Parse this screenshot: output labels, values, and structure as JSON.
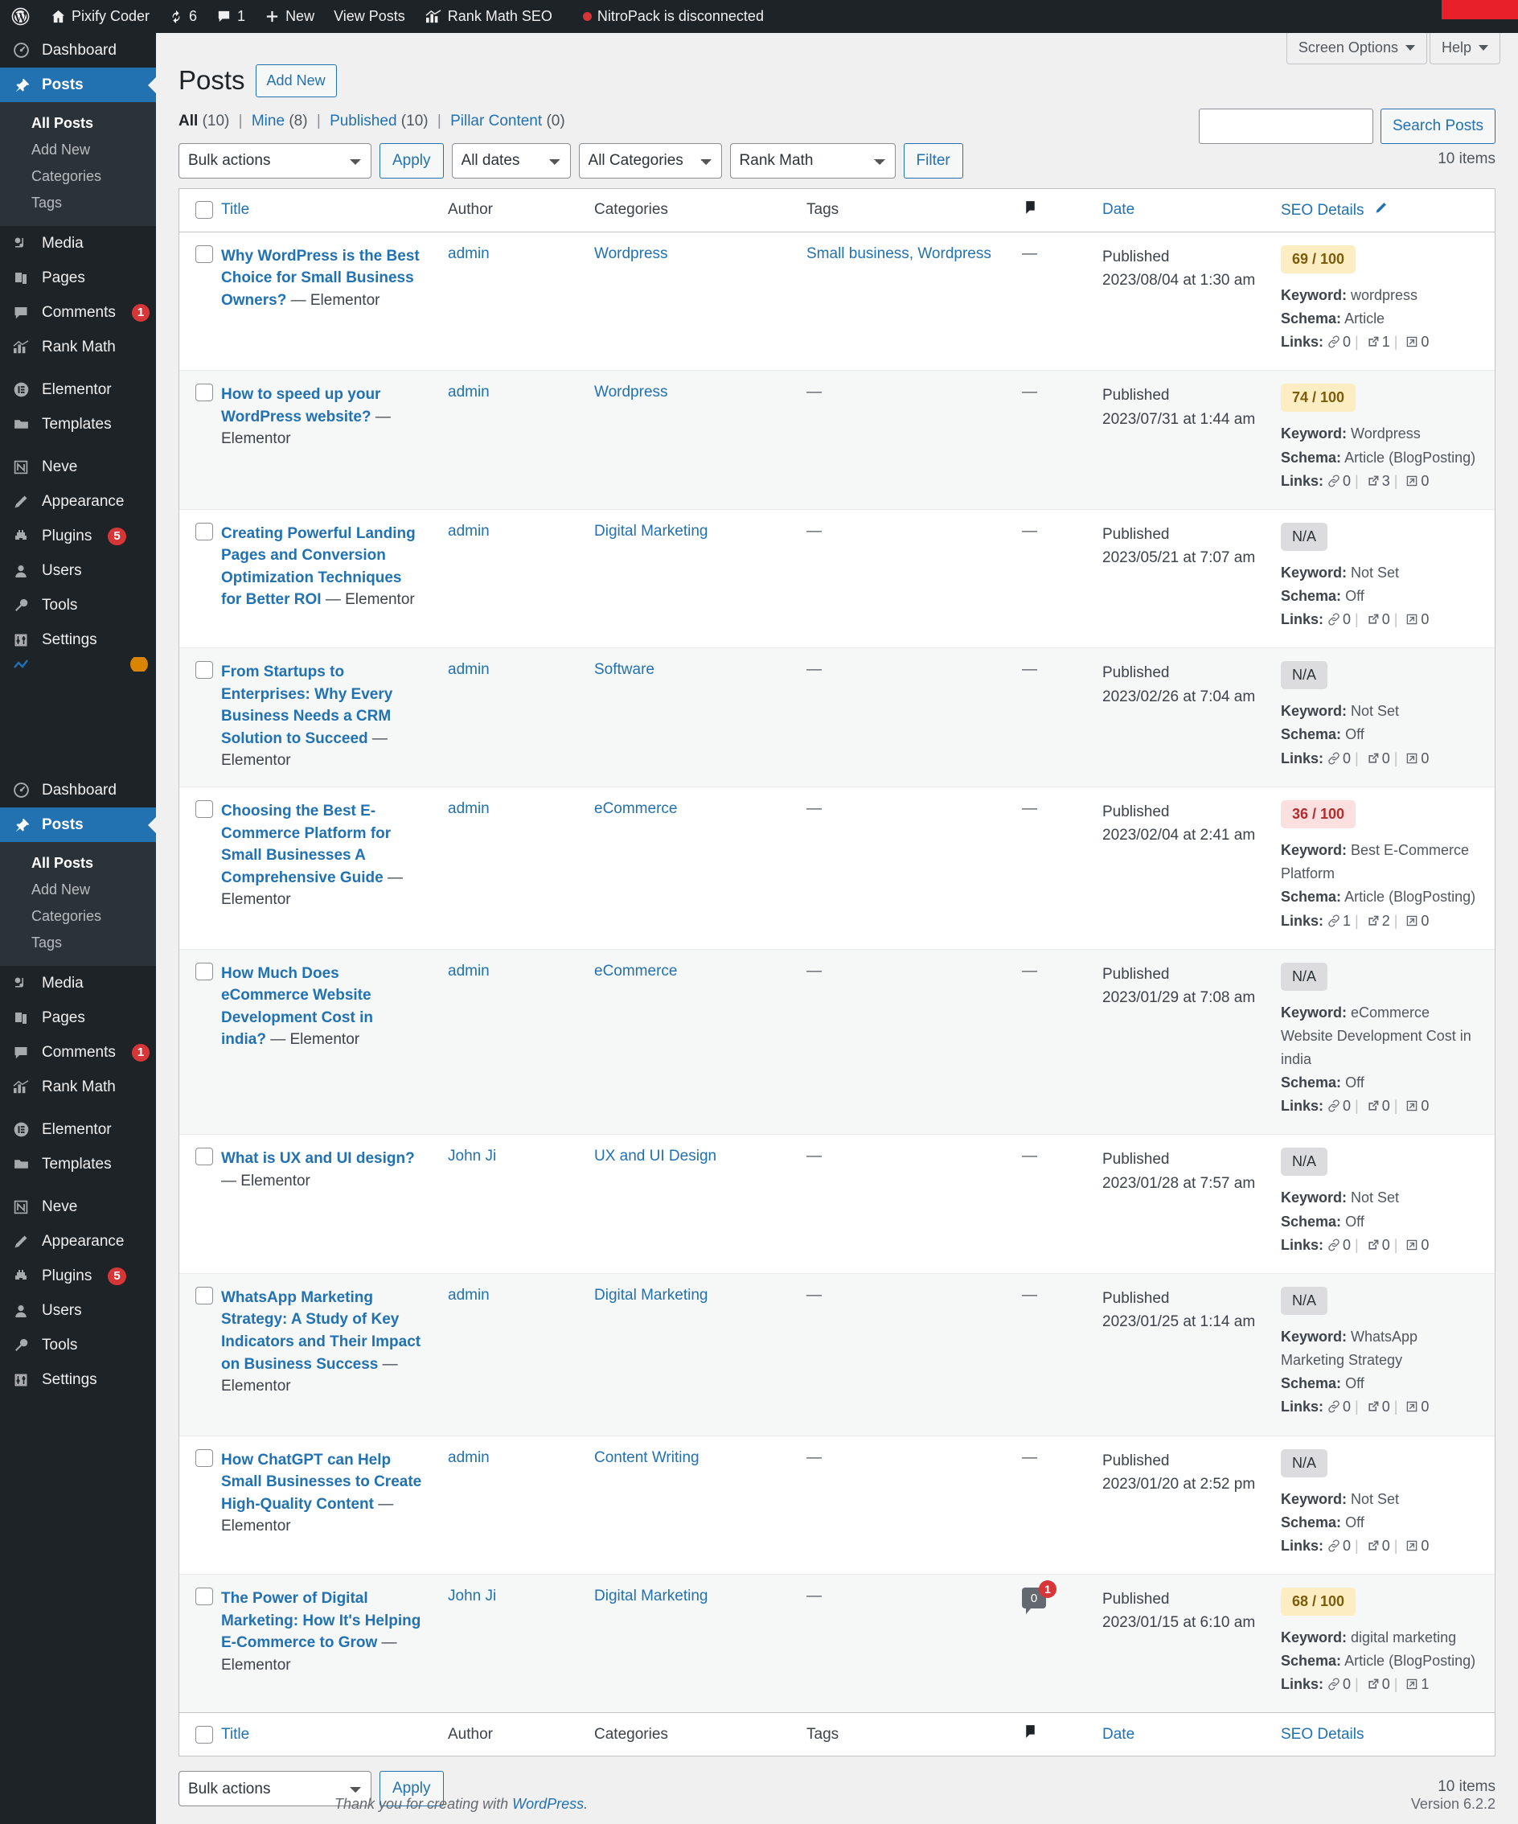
{
  "adminbar": {
    "wp_logo": "wordpress-logo-icon",
    "site_name": "Pixify Coder",
    "updates_count": "6",
    "comments_count": "1",
    "new_label": "New",
    "view_posts_label": "View Posts",
    "rank_math_label": "Rank Math SEO",
    "nitropack_label": "NitroPack is disconnected"
  },
  "sidebar": {
    "groups": [
      {
        "items": [
          {
            "label": "Dashboard",
            "icon": "dashboard-icon",
            "current": false
          },
          {
            "label": "Posts",
            "icon": "pin-icon",
            "current": true,
            "submenu": [
              {
                "label": "All Posts",
                "current": true
              },
              {
                "label": "Add New",
                "current": false
              },
              {
                "label": "Categories",
                "current": false
              },
              {
                "label": "Tags",
                "current": false
              }
            ]
          },
          {
            "label": "Media",
            "icon": "media-icon",
            "current": false
          },
          {
            "label": "Pages",
            "icon": "pages-icon",
            "current": false
          },
          {
            "label": "Comments",
            "icon": "comment-icon",
            "current": false,
            "badge": "1"
          },
          {
            "label": "Rank Math",
            "icon": "rank-math-icon",
            "current": false
          },
          {
            "label": "Elementor",
            "icon": "elementor-icon",
            "current": false
          },
          {
            "label": "Templates",
            "icon": "folder-icon",
            "current": false
          },
          {
            "label": "Neve",
            "icon": "neve-icon",
            "current": false
          },
          {
            "label": "Appearance",
            "icon": "appearance-icon",
            "current": false
          },
          {
            "label": "Plugins",
            "icon": "plugins-icon",
            "current": false,
            "badge": "5"
          },
          {
            "label": "Users",
            "icon": "users-icon",
            "current": false
          },
          {
            "label": "Tools",
            "icon": "tools-icon",
            "current": false
          },
          {
            "label": "Settings",
            "icon": "settings-icon",
            "current": false
          }
        ]
      },
      {
        "items": [
          {
            "label": "Dashboard",
            "icon": "dashboard-icon",
            "current": false
          },
          {
            "label": "Posts",
            "icon": "pin-icon",
            "current": true,
            "submenu": [
              {
                "label": "All Posts",
                "current": true
              },
              {
                "label": "Add New",
                "current": false
              },
              {
                "label": "Categories",
                "current": false
              },
              {
                "label": "Tags",
                "current": false
              }
            ]
          },
          {
            "label": "Media",
            "icon": "media-icon",
            "current": false
          },
          {
            "label": "Pages",
            "icon": "pages-icon",
            "current": false
          },
          {
            "label": "Comments",
            "icon": "comment-icon",
            "current": false,
            "badge": "1"
          },
          {
            "label": "Rank Math",
            "icon": "rank-math-icon",
            "current": false
          },
          {
            "label": "Elementor",
            "icon": "elementor-icon",
            "current": false
          },
          {
            "label": "Templates",
            "icon": "folder-icon",
            "current": false
          },
          {
            "label": "Neve",
            "icon": "neve-icon",
            "current": false
          },
          {
            "label": "Appearance",
            "icon": "appearance-icon",
            "current": false
          },
          {
            "label": "Plugins",
            "icon": "plugins-icon",
            "current": false,
            "badge": "5"
          },
          {
            "label": "Users",
            "icon": "users-icon",
            "current": false
          },
          {
            "label": "Tools",
            "icon": "tools-icon",
            "current": false
          },
          {
            "label": "Settings",
            "icon": "settings-icon",
            "current": false
          }
        ]
      }
    ]
  },
  "screen_meta": {
    "screen_options": "Screen Options",
    "help": "Help"
  },
  "page": {
    "title": "Posts",
    "add_new": "Add New"
  },
  "views": {
    "all_label": "All",
    "all_count": "(10)",
    "mine_label": "Mine",
    "mine_count": "(8)",
    "published_label": "Published",
    "published_count": "(10)",
    "pillar_label": "Pillar Content",
    "pillar_count": "(0)",
    "sep": "|"
  },
  "search": {
    "value": "",
    "placeholder": "",
    "button": "Search Posts"
  },
  "tablenav": {
    "bulk_actions": "Bulk actions",
    "apply": "Apply",
    "all_dates": "All dates",
    "all_categories": "All Categories",
    "rank_math": "Rank Math",
    "filter": "Filter",
    "items_count": "10 items"
  },
  "columns": {
    "title": "Title",
    "author": "Author",
    "categories": "Categories",
    "tags": "Tags",
    "comments": "comment-icon",
    "date": "Date",
    "seo_details": "SEO Details"
  },
  "rows": [
    {
      "title": "Why WordPress is the Best Choice for Small Business Owners?",
      "title_suffix": " — Elementor",
      "author": "admin",
      "categories": "Wordpress",
      "tags": "Small business, Wordpress",
      "comments": "—",
      "status": "Published",
      "date": "2023/08/04 at 1:30 am",
      "seo_score": "69 / 100",
      "seo_state": "good",
      "keyword": "wordpress",
      "schema": "Article",
      "links_internal": "0",
      "links_external": "1",
      "links_incoming": "0"
    },
    {
      "title": "How to speed up your WordPress website?",
      "title_suffix": " — Elementor",
      "author": "admin",
      "categories": "Wordpress",
      "tags": "—",
      "comments": "—",
      "status": "Published",
      "date": "2023/07/31 at 1:44 am",
      "seo_score": "74 / 100",
      "seo_state": "good",
      "keyword": "Wordpress",
      "schema": "Article (BlogPosting)",
      "links_internal": "0",
      "links_external": "3",
      "links_incoming": "0"
    },
    {
      "title": "Creating Powerful Landing Pages and Conversion Optimization Techniques for Better ROI",
      "title_suffix": " — Elementor",
      "author": "admin",
      "categories": "Digital Marketing",
      "tags": "—",
      "comments": "—",
      "status": "Published",
      "date": "2023/05/21 at 7:07 am",
      "seo_score": "N/A",
      "seo_state": "na",
      "keyword": "Not Set",
      "schema": "Off",
      "links_internal": "0",
      "links_external": "0",
      "links_incoming": "0"
    },
    {
      "title": "From Startups to Enterprises: Why Every Business Needs a CRM Solution to Succeed",
      "title_suffix": " — Elementor",
      "author": "admin",
      "categories": "Software",
      "tags": "—",
      "comments": "—",
      "status": "Published",
      "date": "2023/02/26 at 7:04 am",
      "seo_score": "N/A",
      "seo_state": "na",
      "keyword": "Not Set",
      "schema": "Off",
      "links_internal": "0",
      "links_external": "0",
      "links_incoming": "0"
    },
    {
      "title": "Choosing the Best E-Commerce Platform for Small Businesses A Comprehensive Guide",
      "title_suffix": " — Elementor",
      "author": "admin",
      "categories": "eCommerce",
      "tags": "—",
      "comments": "—",
      "status": "Published",
      "date": "2023/02/04 at 2:41 am",
      "seo_score": "36 / 100",
      "seo_state": "bad",
      "keyword": "Best E-Commerce Platform",
      "schema": "Article (BlogPosting)",
      "links_internal": "1",
      "links_external": "2",
      "links_incoming": "0"
    },
    {
      "title": "How Much Does eCommerce Website Development Cost in india?",
      "title_suffix": " — Elementor",
      "author": "admin",
      "categories": "eCommerce",
      "tags": "—",
      "comments": "—",
      "status": "Published",
      "date": "2023/01/29 at 7:08 am",
      "seo_score": "N/A",
      "seo_state": "na",
      "keyword": "eCommerce Website Development Cost in india",
      "schema": "Off",
      "links_internal": "0",
      "links_external": "0",
      "links_incoming": "0"
    },
    {
      "title": "What is UX and UI design?",
      "title_suffix": " — Elementor",
      "author": "John Ji",
      "categories": "UX and UI Design",
      "tags": "—",
      "comments": "—",
      "status": "Published",
      "date": "2023/01/28 at 7:57 am",
      "seo_score": "N/A",
      "seo_state": "na",
      "keyword": "Not Set",
      "schema": "Off",
      "links_internal": "0",
      "links_external": "0",
      "links_incoming": "0"
    },
    {
      "title": "WhatsApp Marketing Strategy: A Study of Key Indicators and Their Impact on Business Success",
      "title_suffix": " — Elementor",
      "author": "admin",
      "categories": "Digital Marketing",
      "tags": "—",
      "comments": "—",
      "status": "Published",
      "date": "2023/01/25 at 1:14 am",
      "seo_score": "N/A",
      "seo_state": "na",
      "keyword": "WhatsApp Marketing Strategy",
      "schema": "Off",
      "links_internal": "0",
      "links_external": "0",
      "links_incoming": "0"
    },
    {
      "title": "How ChatGPT can Help Small Businesses to Create High-Quality Content",
      "title_suffix": " — Elementor",
      "author": "admin",
      "categories": "Content Writing",
      "tags": "—",
      "comments": "—",
      "status": "Published",
      "date": "2023/01/20 at 2:52 pm",
      "seo_score": "N/A",
      "seo_state": "na",
      "keyword": "Not Set",
      "schema": "Off",
      "links_internal": "0",
      "links_external": "0",
      "links_incoming": "0"
    },
    {
      "title": "The Power of Digital Marketing: How It's Helping E-Commerce to Grow",
      "title_suffix": " — Elementor",
      "author": "John Ji",
      "categories": "Digital Marketing",
      "tags": "—",
      "comments": "0",
      "comment_badge": "1",
      "status": "Published",
      "date": "2023/01/15 at 6:10 am",
      "seo_score": "68 / 100",
      "seo_state": "good",
      "keyword": "digital marketing",
      "schema": "Article (BlogPosting)",
      "links_internal": "0",
      "links_external": "0",
      "links_incoming": "1"
    }
  ],
  "seo_labels": {
    "keyword": "Keyword:",
    "schema": "Schema:",
    "links": "Links:"
  },
  "footer": {
    "thanks_prefix": "Thank you for creating with ",
    "wordpress": "WordPress",
    "period": ".",
    "version": "Version 6.2.2"
  },
  "colors": {
    "accent": "#2271b1",
    "sidebar_bg": "#1d2327",
    "danger": "#d63638",
    "score_good_bg": "#fdedc3",
    "score_bad_bg": "#fcdfdf"
  }
}
